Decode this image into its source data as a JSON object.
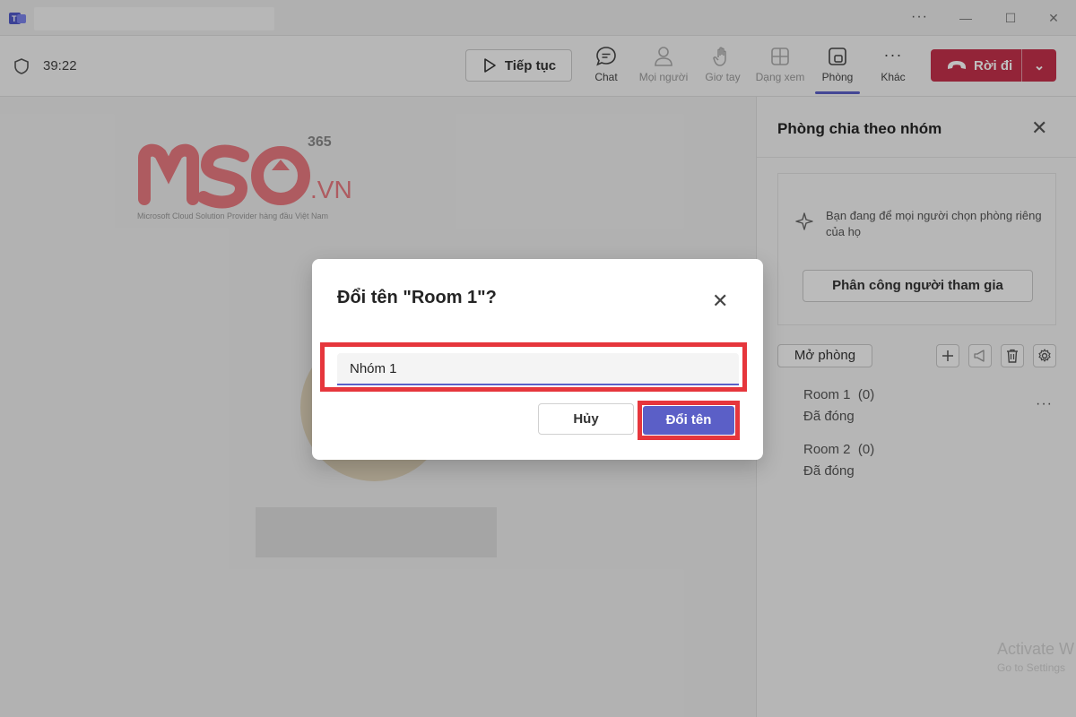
{
  "window": {
    "more_glyph": "···",
    "minimize_glyph": "—",
    "maximize_glyph": "☐",
    "close_glyph": "✕"
  },
  "toolbar": {
    "timer": "39:22",
    "resume_label": "Tiếp tục",
    "tools": [
      {
        "label": "Chat",
        "icon": "chat-icon"
      },
      {
        "label": "Mọi người",
        "icon": "people-icon"
      },
      {
        "label": "Giơ tay",
        "icon": "raise-hand-icon"
      },
      {
        "label": "Dạng xem",
        "icon": "view-icon"
      },
      {
        "label": "Phòng",
        "icon": "rooms-icon"
      },
      {
        "label": "Khác",
        "icon": "more-icon"
      }
    ],
    "more_glyph": "···",
    "leave_label": "Rời đi",
    "leave_chevron": "⌄"
  },
  "stage": {
    "logo_365": "365",
    "logo_vn": ".VN",
    "logo_tagline": "Microsoft Cloud Solution Provider hàng đầu Việt Nam"
  },
  "panel": {
    "title": "Phòng chia theo nhóm",
    "close_glyph": "✕",
    "info_text": "Bạn đang để mọi người chọn phòng riêng của họ",
    "assign_label": "Phân công người tham gia",
    "open_label": "Mở phòng",
    "rooms": [
      {
        "name": "Room 1",
        "count": "(0)",
        "status": "Đã đóng"
      },
      {
        "name": "Room 2",
        "count": "(0)",
        "status": "Đã đóng"
      }
    ],
    "more_glyph": "···",
    "watermark_title": "Activate W",
    "watermark_sub": "Go to Settings"
  },
  "dialog": {
    "title": "Đổi tên \"Room 1\"?",
    "close_glyph": "✕",
    "input_value": "Nhóm 1",
    "cancel_label": "Hủy",
    "confirm_label": "Đổi tên"
  },
  "colors": {
    "accent": "#5b5fc7",
    "leave": "#c4314b",
    "highlight": "#e6363c",
    "logo": "#e87a80"
  }
}
